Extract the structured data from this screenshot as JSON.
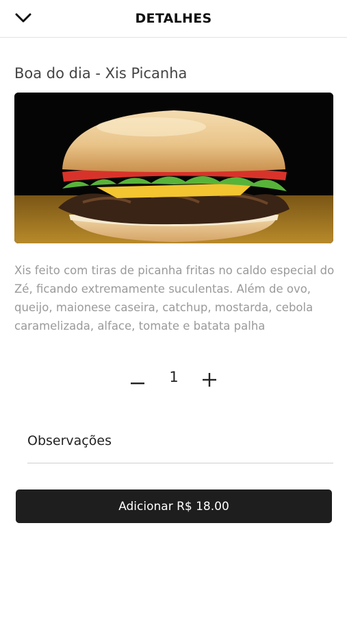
{
  "header": {
    "title": "DETALHES",
    "back_icon": "chevron-down-icon"
  },
  "product": {
    "name": "Boa do dia - Xis Picanha",
    "image_icon": "burger-photo",
    "description": "Xis feito com tiras de picanha fritas no caldo especial do Zé, ficando extremamente suculentas. Além de ovo, queijo, maionese caseira, catchup, mostarda, cebola caramelizada, alface, tomate e batata palha"
  },
  "quantity": {
    "value": "1",
    "decrement_icon": "minus-icon",
    "increment_icon": "plus-icon"
  },
  "observations": {
    "placeholder": "Observações",
    "value": ""
  },
  "add_button": {
    "label": "Adicionar R$ 18.00"
  },
  "colors": {
    "button_bg": "#1e1e1e",
    "description_text": "#9a9a9a",
    "header_border": "#e2e2e2"
  }
}
